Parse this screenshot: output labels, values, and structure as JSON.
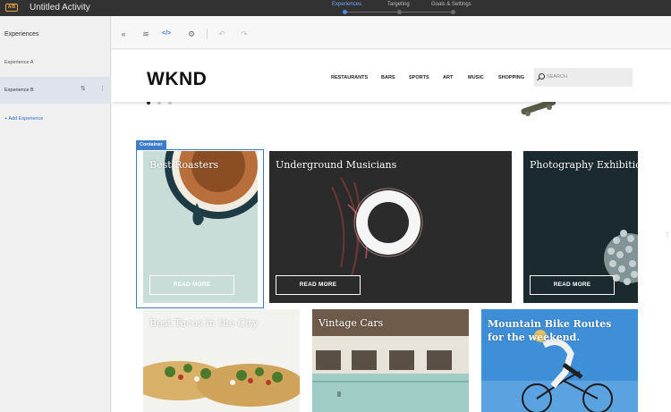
{
  "topbar": {
    "badge": "A/B",
    "activity_title": "Untitled Activity",
    "steps": [
      {
        "label": "Experiences",
        "active": true
      },
      {
        "label": "Targeting",
        "active": false
      },
      {
        "label": "Goals & Settings",
        "active": false
      }
    ]
  },
  "left_panel": {
    "title": "Experiences",
    "experiences": [
      {
        "label": "Experience A",
        "selected": false
      },
      {
        "label": "Experience B",
        "selected": true
      }
    ],
    "add_label": "+ Add Experience"
  },
  "toolbar": {
    "buttons": [
      {
        "name": "collapse-icon",
        "glyph": "«"
      },
      {
        "name": "layers-icon",
        "glyph": "≋"
      },
      {
        "name": "code-icon",
        "glyph": "</>"
      },
      {
        "name": "gear-icon",
        "glyph": "⚙"
      },
      {
        "name": "undo-icon",
        "glyph": "↶"
      },
      {
        "name": "redo-icon",
        "glyph": "↷"
      }
    ]
  },
  "site": {
    "logo": "WKND",
    "nav": [
      "RESTAURANTS",
      "BARS",
      "SPORTS",
      "ART",
      "MUSIC",
      "SHOPPING"
    ],
    "search_placeholder": "SEARCH"
  },
  "editor": {
    "container_label": "Container"
  },
  "cards_row1": [
    {
      "title": "Best Roasters",
      "button": "READ MORE"
    },
    {
      "title": "Underground Musicians",
      "button": "READ MORE"
    },
    {
      "title": "Photography Exhibitions",
      "button": "READ MORE"
    }
  ],
  "cards_row2": [
    {
      "title": "Best Tacos in the City"
    },
    {
      "title": "Vintage Cars"
    },
    {
      "title": "Mountain Bike Routes for the weekend."
    }
  ],
  "colors": {
    "accent": "#3d7cc9",
    "topbar_bg": "#323232",
    "badge": "#e3a64b"
  }
}
